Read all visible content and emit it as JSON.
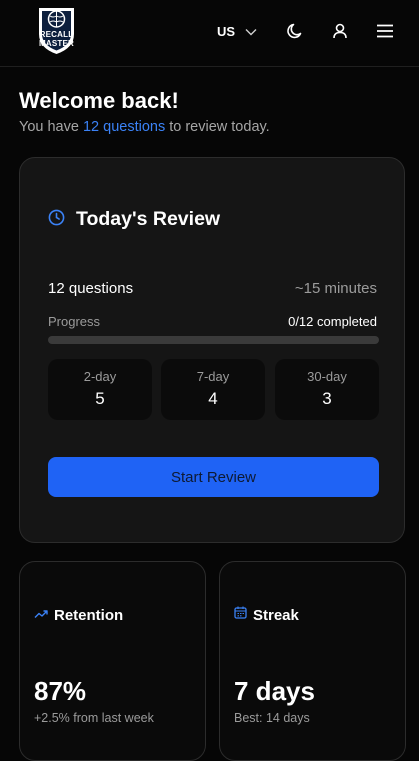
{
  "header": {
    "logo": {
      "line1": "RECALL",
      "line2": "MASTER"
    },
    "language": "US",
    "icons": [
      "chevron-down-icon",
      "moon-icon",
      "user-icon",
      "menu-icon"
    ]
  },
  "welcome": {
    "title": "Welcome back!",
    "subtitle_prefix": "You have ",
    "subtitle_highlight": "12 questions",
    "subtitle_suffix": " to review today."
  },
  "review": {
    "title": "Today's Review",
    "question_count": "12 questions",
    "duration": "~15 minutes",
    "progress_label": "Progress",
    "progress_status": "0/12 completed",
    "progress_fraction": 0,
    "intervals": [
      {
        "label": "2-day",
        "value": "5"
      },
      {
        "label": "7-day",
        "value": "4"
      },
      {
        "label": "30-day",
        "value": "3"
      }
    ],
    "button_label": "Start Review"
  },
  "stats": {
    "retention": {
      "title": "Retention",
      "value": "87%",
      "sub": "+2.5% from last week"
    },
    "streak": {
      "title": "Streak",
      "value": "7 days",
      "sub": "Best: 14 days"
    }
  },
  "colors": {
    "accent": "#1f63f5",
    "highlight": "#3b82f6",
    "background": "#060606",
    "card": "#151515"
  }
}
